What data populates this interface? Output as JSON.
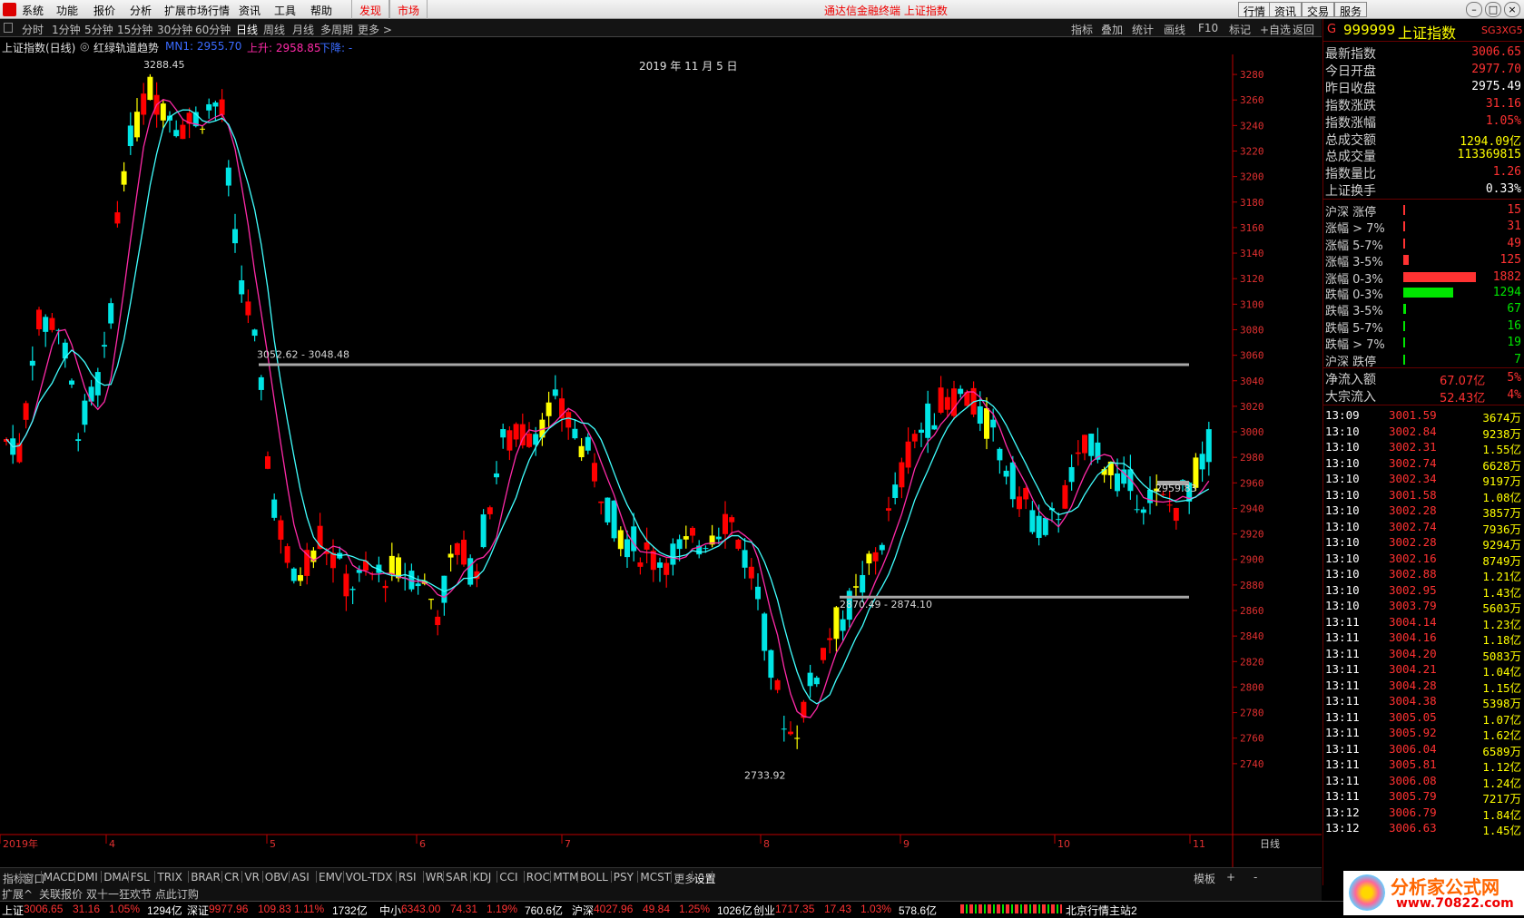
{
  "menubar": {
    "items": [
      "系统",
      "功能",
      "报价",
      "分析",
      "扩展市场行情",
      "资讯",
      "工具",
      "帮助"
    ],
    "highlight": [
      "发现",
      "市场"
    ],
    "title": "通达信金融终端  上证指数",
    "right_buttons": [
      "行情",
      "资讯",
      "交易",
      "服务"
    ],
    "window_buttons": [
      "–",
      "□",
      "×"
    ]
  },
  "periodbar": {
    "periods": [
      "分时",
      "1分钟",
      "5分钟",
      "15分钟",
      "30分钟",
      "60分钟",
      "日线",
      "周线",
      "月线",
      "多周期",
      "更多 >"
    ],
    "active": "日线",
    "tools": [
      "指标",
      "叠加",
      "统计",
      "画线",
      "F10",
      "标记",
      "+自选",
      "返回"
    ]
  },
  "chart_header": {
    "title": "上证指数(日线)",
    "indicator": "红绿轨道趋势",
    "mn1_label": "MN1: 2955.70",
    "up_label": "上升: 2958.85",
    "down_label": "下降: -",
    "date_label": "2019 年 11 月 5 日"
  },
  "chart_data": {
    "type": "candlestick",
    "y_ticks": [
      3280,
      3260,
      3240,
      3220,
      3200,
      3180,
      3160,
      3140,
      3120,
      3100,
      3080,
      3060,
      3040,
      3020,
      3000,
      2980,
      2960,
      2940,
      2920,
      2900,
      2880,
      2860,
      2840,
      2820,
      2800,
      2780,
      2760,
      2740
    ],
    "ylim": [
      2720,
      3290
    ],
    "x_labels": [
      "2019年",
      "4",
      "5",
      "6",
      "7",
      "8",
      "9",
      "10",
      "11"
    ],
    "x_label_right": "日线",
    "annotations": [
      "3288.45",
      "3052.62 - 3048.48",
      "2870.49 - 2874.10",
      "2733.92",
      "2959.83"
    ],
    "levels": [
      3052.62,
      2870.49,
      2959.83
    ],
    "colors": {
      "up": "#ff0000",
      "down": "#00e5e5",
      "yellow": "#ffff00",
      "ma1": "#ff2aa8",
      "ma2": "#40ffff",
      "level": "#a8a8a8"
    }
  },
  "indicator_tabs": [
    "指标",
    "窗口",
    "MACD",
    "DMI",
    "DMA",
    "FSL",
    "TRIX",
    "BRAR",
    "CR",
    "VR",
    "OBV",
    "ASI",
    "EMV",
    "VOL-TDX",
    "RSI",
    "WR",
    "SAR",
    "KDJ",
    "CCI",
    "ROC",
    "MTM",
    "BOLL",
    "PSY",
    "MCST",
    "更多",
    "设置"
  ],
  "indicator_right": [
    "模板",
    "+",
    "-"
  ],
  "ext_row": [
    "扩展^",
    "关联报价",
    "双十一狂欢节 点此订购"
  ],
  "quote_bar": [
    {
      "n": "上证",
      "p": "3006.65",
      "c": "31.16",
      "pc": "1.05%",
      "a": "1294亿"
    },
    {
      "n": "深证",
      "p": "9977.96",
      "c": "109.83",
      "pc": "1.11%",
      "a": "1732亿"
    },
    {
      "n": "中小",
      "p": "6343.00",
      "c": "74.31",
      "pc": "1.19%",
      "a": "760.6亿"
    },
    {
      "n": "沪深",
      "p": "4027.96",
      "c": "49.84",
      "pc": "1.25%",
      "a": "1026亿"
    },
    {
      "n": "创业",
      "p": "1717.35",
      "c": "17.43",
      "pc": "1.03%",
      "a": "578.6亿"
    }
  ],
  "status_station": "北京行情主站2",
  "watermark": {
    "title": "分析家公式网",
    "url": "www.70822.com"
  },
  "rpanel": {
    "code": "999999",
    "name": "上证指数",
    "tag": "SG3XG5",
    "g": "G",
    "stats": [
      {
        "l": "最新指数",
        "v": "3006.65",
        "c": "red"
      },
      {
        "l": "今日开盘",
        "v": "2977.70",
        "c": "red"
      },
      {
        "l": "昨日收盘",
        "v": "2975.49",
        "c": "white"
      },
      {
        "l": "指数涨跌",
        "v": "31.16",
        "c": "red"
      },
      {
        "l": "指数涨幅",
        "v": "1.05%",
        "c": "red"
      },
      {
        "l": "总成交额",
        "v": "1294.09亿",
        "c": "yellow"
      },
      {
        "l": "总成交量",
        "v": "113369815",
        "c": "yellow"
      },
      {
        "l": "指数量比",
        "v": "1.26",
        "c": "red"
      },
      {
        "l": "上证换手",
        "v": "0.33%",
        "c": "white"
      }
    ],
    "ups": [
      {
        "l": "沪深 涨停",
        "v": "15",
        "bar": 0.01
      },
      {
        "l": "涨幅 > 7%",
        "v": "31",
        "bar": 0.02
      },
      {
        "l": "涨幅 5-7%",
        "v": "49",
        "bar": 0.03
      },
      {
        "l": "涨幅 3-5%",
        "v": "125",
        "bar": 0.07
      },
      {
        "l": "涨幅 0-3%",
        "v": "1882",
        "bar": 1.0
      }
    ],
    "downs": [
      {
        "l": "跌幅 0-3%",
        "v": "1294",
        "bar": 0.69
      },
      {
        "l": "跌幅 3-5%",
        "v": "67",
        "bar": 0.035
      },
      {
        "l": "跌幅 5-7%",
        "v": "16",
        "bar": 0.01
      },
      {
        "l": "跌幅 > 7%",
        "v": "19",
        "bar": 0.01
      },
      {
        "l": "沪深 跌停",
        "v": "7",
        "bar": 0.005
      }
    ],
    "flows": [
      {
        "l": "净流入额",
        "v": "67.07亿",
        "p": "5%"
      },
      {
        "l": "大宗流入",
        "v": "52.43亿",
        "p": "4%"
      }
    ],
    "ticks": [
      [
        "13:09",
        "3001.59",
        "3674万"
      ],
      [
        "13:10",
        "3002.84",
        "9238万"
      ],
      [
        "13:10",
        "3002.31",
        "1.55亿"
      ],
      [
        "13:10",
        "3002.74",
        "6628万"
      ],
      [
        "13:10",
        "3002.34",
        "9197万"
      ],
      [
        "13:10",
        "3001.58",
        "1.08亿"
      ],
      [
        "13:10",
        "3002.28",
        "3857万"
      ],
      [
        "13:10",
        "3002.74",
        "7936万"
      ],
      [
        "13:10",
        "3002.28",
        "9294万"
      ],
      [
        "13:10",
        "3002.16",
        "8749万"
      ],
      [
        "13:10",
        "3002.88",
        "1.21亿"
      ],
      [
        "13:10",
        "3002.95",
        "1.43亿"
      ],
      [
        "13:10",
        "3003.79",
        "5603万"
      ],
      [
        "13:11",
        "3004.14",
        "1.23亿"
      ],
      [
        "13:11",
        "3004.16",
        "1.18亿"
      ],
      [
        "13:11",
        "3004.20",
        "5083万"
      ],
      [
        "13:11",
        "3004.21",
        "1.04亿"
      ],
      [
        "13:11",
        "3004.28",
        "1.15亿"
      ],
      [
        "13:11",
        "3004.38",
        "5398万"
      ],
      [
        "13:11",
        "3005.05",
        "1.07亿"
      ],
      [
        "13:11",
        "3005.92",
        "1.62亿"
      ],
      [
        "13:11",
        "3006.04",
        "6589万"
      ],
      [
        "13:11",
        "3005.81",
        "1.12亿"
      ],
      [
        "13:11",
        "3006.08",
        "1.24亿"
      ],
      [
        "13:11",
        "3005.79",
        "7217万"
      ],
      [
        "13:12",
        "3006.79",
        "1.84亿"
      ],
      [
        "13:12",
        "3006.63",
        "1.45亿"
      ]
    ],
    "tick_colors": [
      "red",
      "red",
      "red",
      "red",
      "red",
      "red",
      "red",
      "red",
      "red",
      "red",
      "red",
      "red",
      "red",
      "red",
      "red",
      "red",
      "red",
      "red",
      "red",
      "red",
      "red",
      "red",
      "red",
      "red",
      "red",
      "red",
      "red"
    ],
    "vol_colors": [
      "yellow",
      "yellow",
      "yellow",
      "yellow",
      "yellow",
      "yellow",
      "yellow",
      "yellow",
      "yellow",
      "yellow",
      "yellow",
      "yellow",
      "yellow",
      "yellow",
      "yellow",
      "yellow",
      "yellow",
      "yellow",
      "yellow",
      "yellow",
      "yellow",
      "yellow",
      "yellow",
      "yellow",
      "yellow",
      "yellow",
      "yellow"
    ]
  }
}
